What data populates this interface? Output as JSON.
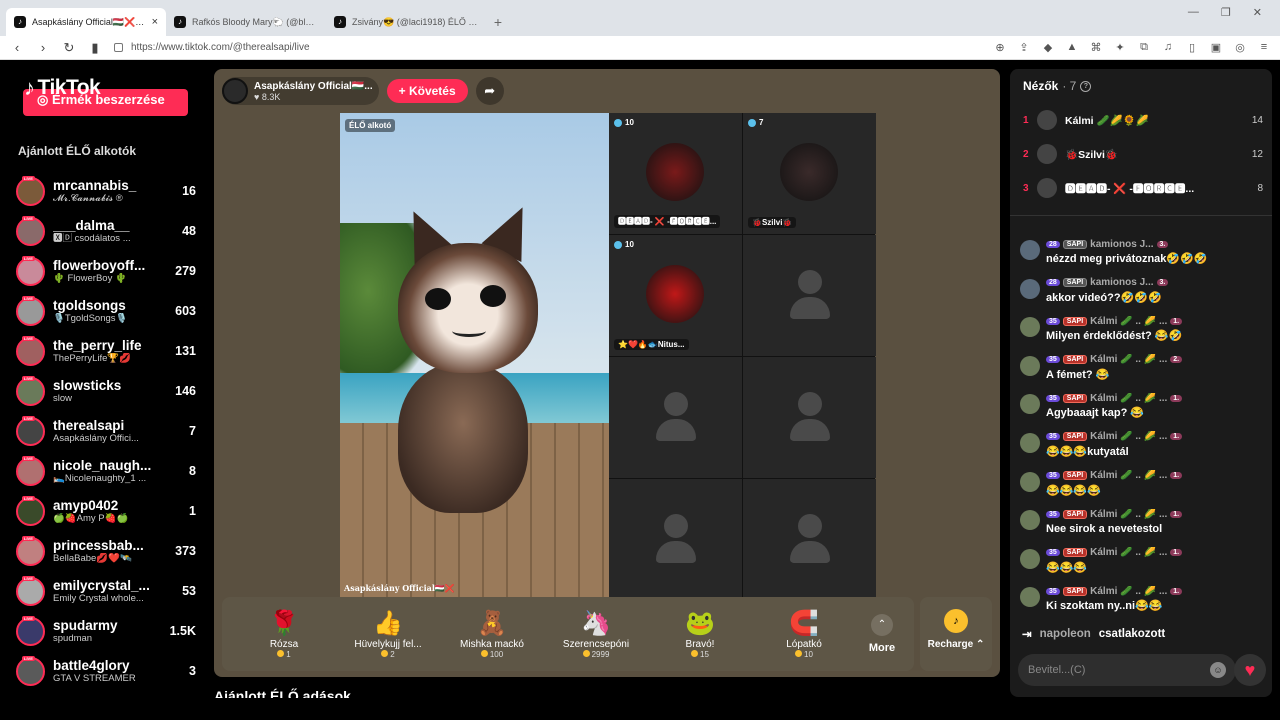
{
  "browser": {
    "tabs": [
      {
        "label": "Asapkáslány Official🇭🇺❌ (@",
        "active": true
      },
      {
        "label": "Rafkós Bloody Mary🐑 (@bloodym",
        "active": false
      },
      {
        "label": "Zsivány😎 (@laci1918) ÉLŐ adás",
        "active": false
      }
    ],
    "url": "https://www.tiktok.com/@therealsapi/live"
  },
  "sidebar": {
    "logo": "TikTok",
    "coins_button": "Érmék beszerzése",
    "title": "Ajánlott ÉLŐ alkotók",
    "creators": [
      {
        "name": "mrcannabis_",
        "sub": "𝓜𝓻.𝓒𝓪𝓷𝓷𝓪𝓫𝓲𝓼 ®",
        "count": "16",
        "color": "#7b5a3a"
      },
      {
        "name": "___dalma__",
        "sub": "🆇🄳 csodálatos ...",
        "count": "48",
        "color": "#8a6a6a"
      },
      {
        "name": "flowerboyoff...",
        "sub": "🌵 FlowerBoy 🌵",
        "count": "279",
        "color": "#c98a9a"
      },
      {
        "name": "tgoldsongs",
        "sub": "🎙️TgoldSongs🎙️",
        "count": "603",
        "color": "#999"
      },
      {
        "name": "the_perry_life",
        "sub": "ThePerryLife🏆💋",
        "count": "131",
        "color": "#a06060"
      },
      {
        "name": "slowsticks",
        "sub": "slow",
        "count": "146",
        "color": "#6a7a5a"
      },
      {
        "name": "therealsapi",
        "sub": "Asapkáslány Offici...",
        "count": "7",
        "color": "#444"
      },
      {
        "name": "nicole_naugh...",
        "sub": "🛌Nicolenaughty_1 ...",
        "count": "8",
        "color": "#b07070"
      },
      {
        "name": "amyp0402",
        "sub": "🍏🍓Amy P🍓🍏",
        "count": "1",
        "color": "#3a4a2a"
      },
      {
        "name": "princessbab...",
        "sub": "BellaBabe💋❤️🛰️",
        "count": "373",
        "color": "#c08080"
      },
      {
        "name": "emilycrystal_...",
        "sub": "Emily Crystal whole...",
        "count": "53",
        "color": "#aaa"
      },
      {
        "name": "spudarmy",
        "sub": "spudman",
        "count": "1.5K",
        "color": "#3a3a6a"
      },
      {
        "name": "battle4glory",
        "sub": "GTA V STREAMER",
        "count": "3",
        "color": "#5a5a5a"
      }
    ]
  },
  "stage": {
    "host_name": "Asapkáslány Official🇭🇺...",
    "host_likes": "♥ 8.3K",
    "follow_label": "+ Követés",
    "live_tag": "ÉLŐ alkotó",
    "watermark": "Asapkáslány Official🇭🇺❌",
    "guests": [
      {
        "count": "10",
        "name": "🅳🅴🅰🅳- ❌ -🅵🅾🆁🅲🅴...",
        "color": "#7a1a1a"
      },
      {
        "count": "7",
        "name": "🐞Szilvi🐞",
        "color": "#3a2a2a"
      },
      {
        "count": "10",
        "name": "⭐❤️🔥🐟Nitus...",
        "color": "#c01818"
      }
    ],
    "gifts": [
      {
        "icon": "🌹",
        "name": "Rózsa",
        "price": "1"
      },
      {
        "icon": "👍",
        "name": "Hüvelykujj fel...",
        "price": "2"
      },
      {
        "icon": "🧸",
        "name": "Mishka mackó",
        "price": "100"
      },
      {
        "icon": "🦄",
        "name": "Szerencsepóni",
        "price": "2999"
      },
      {
        "icon": "🐸",
        "name": "Bravó!",
        "price": "15"
      },
      {
        "icon": "🧲",
        "name": "Lópatkó",
        "price": "10"
      }
    ],
    "more_label": "More",
    "recharge_label": "Recharge ⌃"
  },
  "below_title": "Ajánlott ÉLŐ adások",
  "panel": {
    "viewers_title": "Nézők",
    "viewers_count": "· 7",
    "top_viewers": [
      {
        "rank": "1",
        "name": "Kálmi 🥒🌽🌻🌽",
        "score": "14"
      },
      {
        "rank": "2",
        "name": "🐞Szilvi🐞",
        "score": "12"
      },
      {
        "rank": "3",
        "name": "🅳🅴🅰🅳- ❌ -🅵🅾🆁🅲🅴...",
        "score": "8"
      }
    ],
    "messages": [
      {
        "level": "28",
        "fan": "SAPI",
        "fan_grey": true,
        "user": "kamionos J...",
        "rank": "3.",
        "text": "nézzd meg privátoznak🤣🤣🤣"
      },
      {
        "level": "28",
        "fan": "SAPI",
        "fan_grey": true,
        "user": "kamionos J...",
        "rank": "3.",
        "text": "akkor videó??🤣🤣🤣"
      },
      {
        "level": "35",
        "fan": "SAPI",
        "fan_grey": false,
        "user": "Kálmi 🥒 .. 🌽 ...",
        "rank": "1.",
        "text": "Milyen érdeklődést? 😂🤣"
      },
      {
        "level": "35",
        "fan": "SAPI",
        "fan_grey": false,
        "user": "Kálmi 🥒 .. 🌽 ...",
        "rank": "2.",
        "text": "A fémet? 😂"
      },
      {
        "level": "35",
        "fan": "SAPI",
        "fan_grey": false,
        "user": "Kálmi 🥒 .. 🌽 ...",
        "rank": "1.",
        "text": "Agybaaajt kap? 😂"
      },
      {
        "level": "35",
        "fan": "SAPI",
        "fan_grey": false,
        "user": "Kálmi 🥒 .. 🌽 ...",
        "rank": "1.",
        "text": "😂😂😂kutyatál"
      },
      {
        "level": "35",
        "fan": "SAPI",
        "fan_grey": false,
        "user": "Kálmi 🥒 .. 🌽 ...",
        "rank": "1.",
        "text": "😂😂😂😂"
      },
      {
        "level": "35",
        "fan": "SAPI",
        "fan_grey": false,
        "user": "Kálmi 🥒 .. 🌽 ...",
        "rank": "1.",
        "text": "Nee sirok a nevetestol"
      },
      {
        "level": "35",
        "fan": "SAPI",
        "fan_grey": false,
        "user": "Kálmi 🥒 .. 🌽 ...",
        "rank": "1.",
        "text": "😂😂😂"
      },
      {
        "level": "35",
        "fan": "SAPI",
        "fan_grey": false,
        "user": "Kálmi 🥒 .. 🌽 ...",
        "rank": "1.",
        "text": "Ki szoktam ny..ni😂😂"
      }
    ],
    "join_user": "napoleon",
    "join_text": "csatlakozott",
    "input_placeholder": "Bevitel...(C)"
  }
}
